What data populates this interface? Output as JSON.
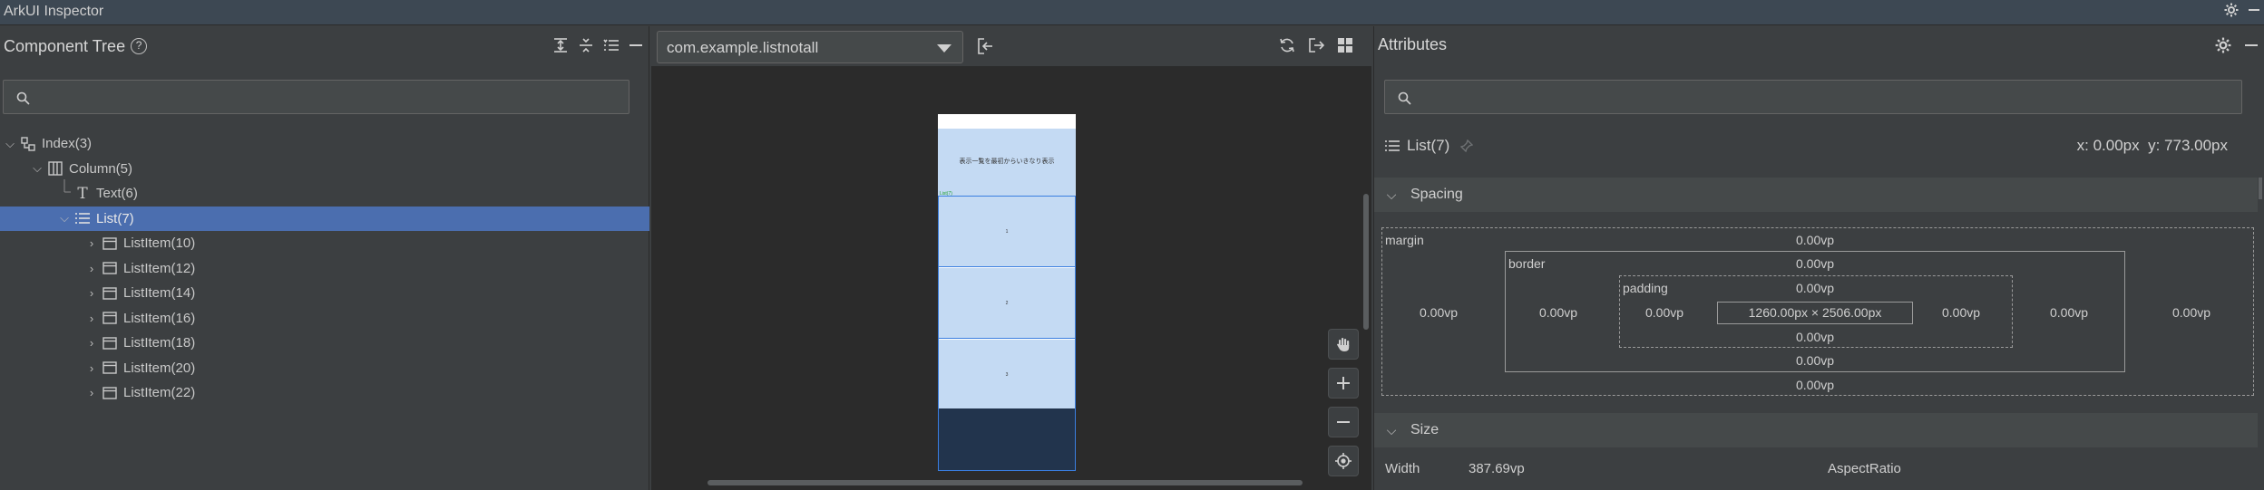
{
  "app": {
    "title": "ArkUI Inspector"
  },
  "component_tree": {
    "title": "Component Tree",
    "help": "?",
    "search_placeholder": "",
    "nodes": [
      {
        "label": "Index(3)",
        "expanded": true,
        "icon": "index-icon"
      },
      {
        "label": "Column(5)",
        "expanded": true,
        "icon": "column-icon"
      },
      {
        "label": "Text(6)",
        "expanded": null,
        "icon": "text-icon"
      },
      {
        "label": "List(7)",
        "expanded": true,
        "icon": "list-icon",
        "selected": true
      },
      {
        "label": "ListItem(10)",
        "expanded": false,
        "icon": "listitem-icon"
      },
      {
        "label": "ListItem(12)",
        "expanded": false,
        "icon": "listitem-icon"
      },
      {
        "label": "ListItem(14)",
        "expanded": false,
        "icon": "listitem-icon"
      },
      {
        "label": "ListItem(16)",
        "expanded": false,
        "icon": "listitem-icon"
      },
      {
        "label": "ListItem(18)",
        "expanded": false,
        "icon": "listitem-icon"
      },
      {
        "label": "ListItem(20)",
        "expanded": false,
        "icon": "listitem-icon"
      },
      {
        "label": "ListItem(22)",
        "expanded": false,
        "icon": "listitem-icon"
      }
    ]
  },
  "preview": {
    "app_select": "com.example.listnotall",
    "device_text": "表示一覧を最初からいきなり表示",
    "list_tag": "List(7)",
    "items": [
      "1",
      "2",
      "3"
    ]
  },
  "attributes": {
    "title": "Attributes",
    "search_placeholder": "",
    "node": "List(7)",
    "x_label": "x: 0.00px",
    "y_label": "y: 773.00px",
    "spacing_title": "Spacing",
    "size_title": "Size",
    "margin_label": "margin",
    "border_label": "border",
    "padding_label": "padding",
    "margin_top": "0.00vp",
    "margin_bottom": "0.00vp",
    "margin_left": "0.00vp",
    "margin_right": "0.00vp",
    "border_top": "0.00vp",
    "border_bottom": "0.00vp",
    "border_left": "0.00vp",
    "border_right": "0.00vp",
    "padding_top": "0.00vp",
    "padding_bottom": "0.00vp",
    "padding_left": "0.00vp",
    "padding_right": "0.00vp",
    "content_size": "1260.00px × 2506.00px",
    "width_label": "Width",
    "width_value": "387.69vp",
    "aspect_label": "AspectRatio"
  },
  "colors": {
    "selection": "#4b6eaf",
    "device_fill": "#c4daf3",
    "device_border": "#3a7ee0"
  }
}
